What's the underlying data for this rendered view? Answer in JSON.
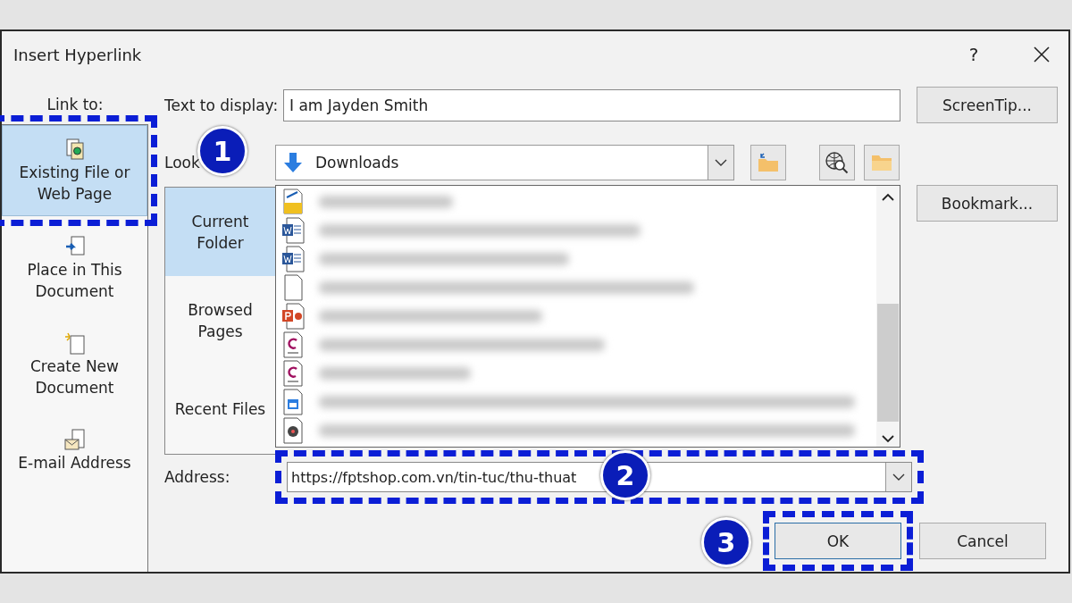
{
  "window": {
    "title": "Insert Hyperlink",
    "help": "?"
  },
  "link_to": {
    "label": "Link to:",
    "items": [
      {
        "label": "Existing File or Web Page",
        "kind": "file",
        "selected": true,
        "highlighted": true
      },
      {
        "label": "Place in This Document",
        "kind": "place",
        "selected": false,
        "highlighted": false
      },
      {
        "label": "Create New Document",
        "kind": "new",
        "selected": false,
        "highlighted": false
      },
      {
        "label": "E-mail Address",
        "kind": "email",
        "selected": false,
        "highlighted": false
      }
    ]
  },
  "text_to_display": {
    "label": "Text to display:",
    "value": "I am Jayden Smith"
  },
  "look_in": {
    "label": "Look",
    "value": "Downloads"
  },
  "side_buttons": [
    "ScreenTip...",
    "Bookmark..."
  ],
  "tabs": [
    {
      "label": "Current Folder",
      "selected": true
    },
    {
      "label": "Browsed Pages",
      "selected": false
    },
    {
      "label": "Recent Files",
      "selected": false
    }
  ],
  "files": [
    {
      "kind": "dwg"
    },
    {
      "kind": "word"
    },
    {
      "kind": "word"
    },
    {
      "kind": "blank"
    },
    {
      "kind": "powerpoint"
    },
    {
      "kind": "fxp"
    },
    {
      "kind": "fxp"
    },
    {
      "kind": "window"
    },
    {
      "kind": "disc"
    }
  ],
  "address": {
    "label": "Address:",
    "value": "https://fptshop.com.vn/tin-tuc/thu-thuat",
    "highlighted": true
  },
  "buttons": [
    {
      "label": "OK",
      "highlighted": true
    },
    {
      "label": "Cancel",
      "highlighted": false
    }
  ],
  "annotations": [
    {
      "number": "1"
    },
    {
      "number": "2"
    },
    {
      "number": "3"
    }
  ]
}
